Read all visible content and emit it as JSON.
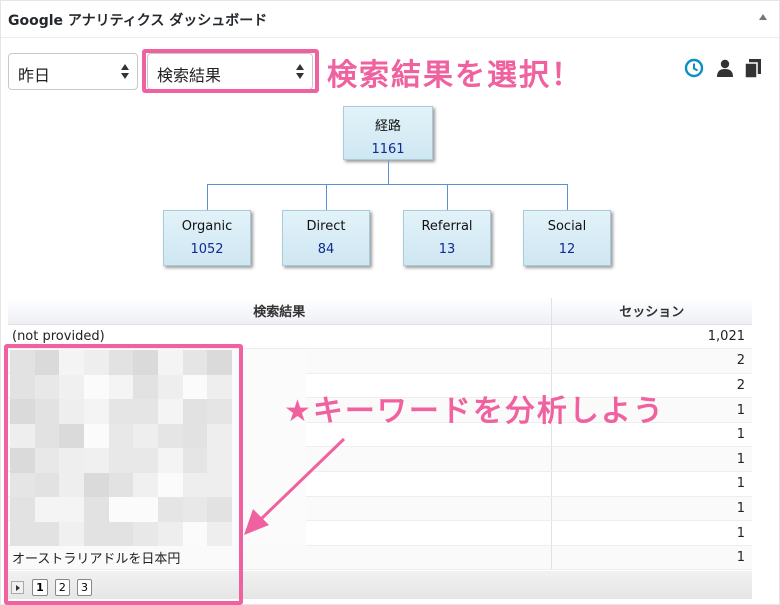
{
  "widget": {
    "title": "Google アナリティクス ダッシュボード"
  },
  "controls": {
    "period_value": "昨日",
    "report_value": "検索結果"
  },
  "annotations": {
    "select_callout": "検索結果を選択！",
    "keyword_callout": "★キーワードを分析しよう"
  },
  "toolbar": {
    "icons": [
      "clock-icon",
      "user-icon",
      "copy-icon"
    ],
    "accent_color": "#0c8fc4"
  },
  "tree": {
    "root": {
      "label": "経路",
      "value": "1161"
    },
    "children": [
      {
        "label": "Organic",
        "value": "1052"
      },
      {
        "label": "Direct",
        "value": "84"
      },
      {
        "label": "Referral",
        "value": "13"
      },
      {
        "label": "Social",
        "value": "12"
      }
    ]
  },
  "table": {
    "headers": [
      "検索結果",
      "セッション"
    ],
    "rows": [
      {
        "query": "(not provided)",
        "sessions": "1,021"
      },
      {
        "query": "",
        "sessions": "2"
      },
      {
        "query": "",
        "sessions": "2"
      },
      {
        "query": "",
        "sessions": "1"
      },
      {
        "query": "",
        "sessions": "1"
      },
      {
        "query": "",
        "sessions": "1"
      },
      {
        "query": "",
        "sessions": "1"
      },
      {
        "query": "",
        "sessions": "1"
      },
      {
        "query": "",
        "sessions": "1"
      },
      {
        "query": "オーストラリアドルを日本円",
        "sessions": "1"
      }
    ]
  },
  "pager": {
    "pages": [
      "1",
      "2",
      "3"
    ],
    "current": "1"
  },
  "colors": {
    "annotation_pink": "#f0619f",
    "node_value_blue": "#102a96",
    "connector_blue": "#5b8fd6"
  }
}
